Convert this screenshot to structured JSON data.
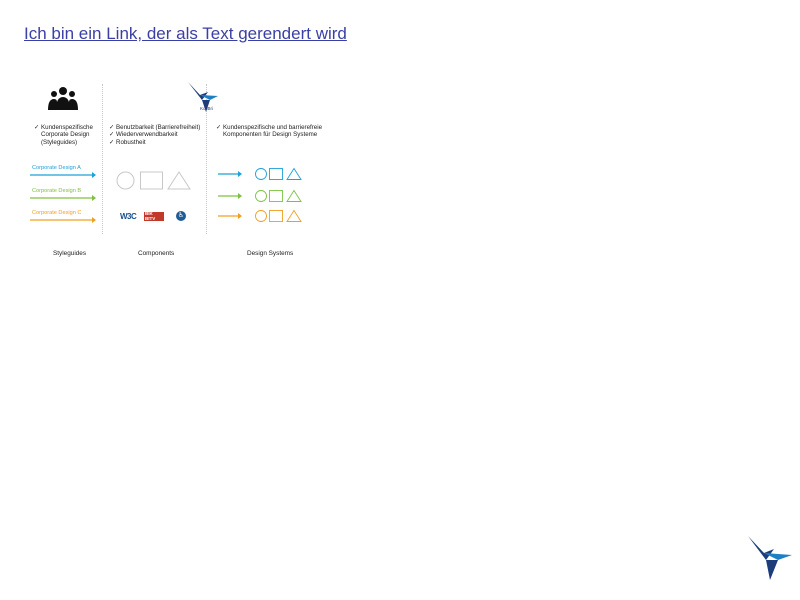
{
  "link": {
    "text": "Ich bin ein Link, der als Text gerendert wird"
  },
  "diagram": {
    "logo_label": "KoliBri",
    "styleguides": {
      "items": [
        "Kundenspezifische\nCorporate Design\n(Styleguides)"
      ],
      "designs": [
        {
          "label": "Corporate Design A",
          "color": "#1ea0d8"
        },
        {
          "label": "Corporate Design B",
          "color": "#7cc242"
        },
        {
          "label": "Corporate Design C",
          "color": "#f0a020"
        }
      ]
    },
    "components": {
      "items": [
        "Benutzbarkeit (Barrierefreiheit)",
        "Wiederverwendbarkeit",
        "Robustheit"
      ],
      "logos": {
        "w3c": "W3C",
        "bik": "BIK BITV Test",
        "access": "♿"
      }
    },
    "design_systems": {
      "items": [
        "Kundenspezifische und barrierefreie\nKomponenten für Design Systeme"
      ]
    },
    "captions": {
      "styleguides": "Styleguides",
      "components": "Components",
      "design_systems": "Design Systems"
    },
    "check_symbol": "✓"
  },
  "colors": {
    "blue": "#1ea0d8",
    "green": "#7cc242",
    "orange": "#f0a020",
    "shape_grey": "#c8c8c8",
    "brand": "#1c3d7a",
    "link": "#3a3fa6"
  },
  "icons": {
    "users": "users-group-icon",
    "logo": "kolibri-hummingbird-logo"
  }
}
